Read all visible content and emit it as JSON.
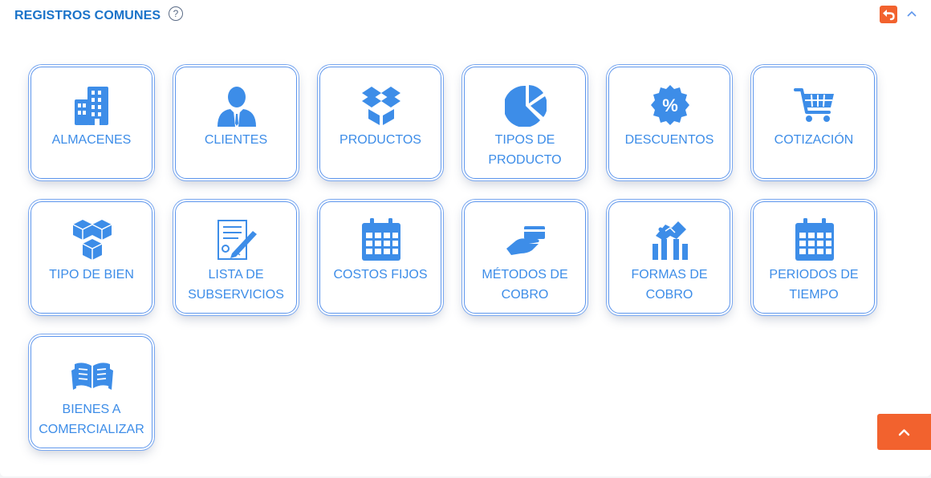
{
  "header": {
    "title": "REGISTROS COMUNES",
    "help_glyph": "?"
  },
  "colors": {
    "accent": "#3d8de8",
    "title": "#1a73c9",
    "action": "#f2622e"
  },
  "tiles": [
    {
      "label": "ALMACENES",
      "icon": "buildings-icon"
    },
    {
      "label": "CLIENTES",
      "icon": "user-tie-icon"
    },
    {
      "label": "PRODUCTOS",
      "icon": "box-icon"
    },
    {
      "label": "TIPOS DE\nPRODUCTO",
      "icon": "pie-chart-icon"
    },
    {
      "label": "DESCUENTOS",
      "icon": "percent-badge-icon"
    },
    {
      "label": "COTIZACIÓN",
      "icon": "shopping-cart-icon"
    },
    {
      "label": "TIPO DE BIEN",
      "icon": "cubes-icon"
    },
    {
      "label": "LISTA DE\nSUBSERVICIOS",
      "icon": "document-pen-icon"
    },
    {
      "label": "COSTOS FIJOS",
      "icon": "calendar-icon"
    },
    {
      "label": "MÉTODOS DE\nCOBRO",
      "icon": "hand-card-icon"
    },
    {
      "label": "FORMAS DE\nCOBRO",
      "icon": "handshake-chart-icon"
    },
    {
      "label": "PERIODOS DE\nTIEMPO",
      "icon": "calendar-icon"
    },
    {
      "label": "BIENES A\nCOMERCIALIZAR",
      "icon": "open-book-icon"
    }
  ]
}
